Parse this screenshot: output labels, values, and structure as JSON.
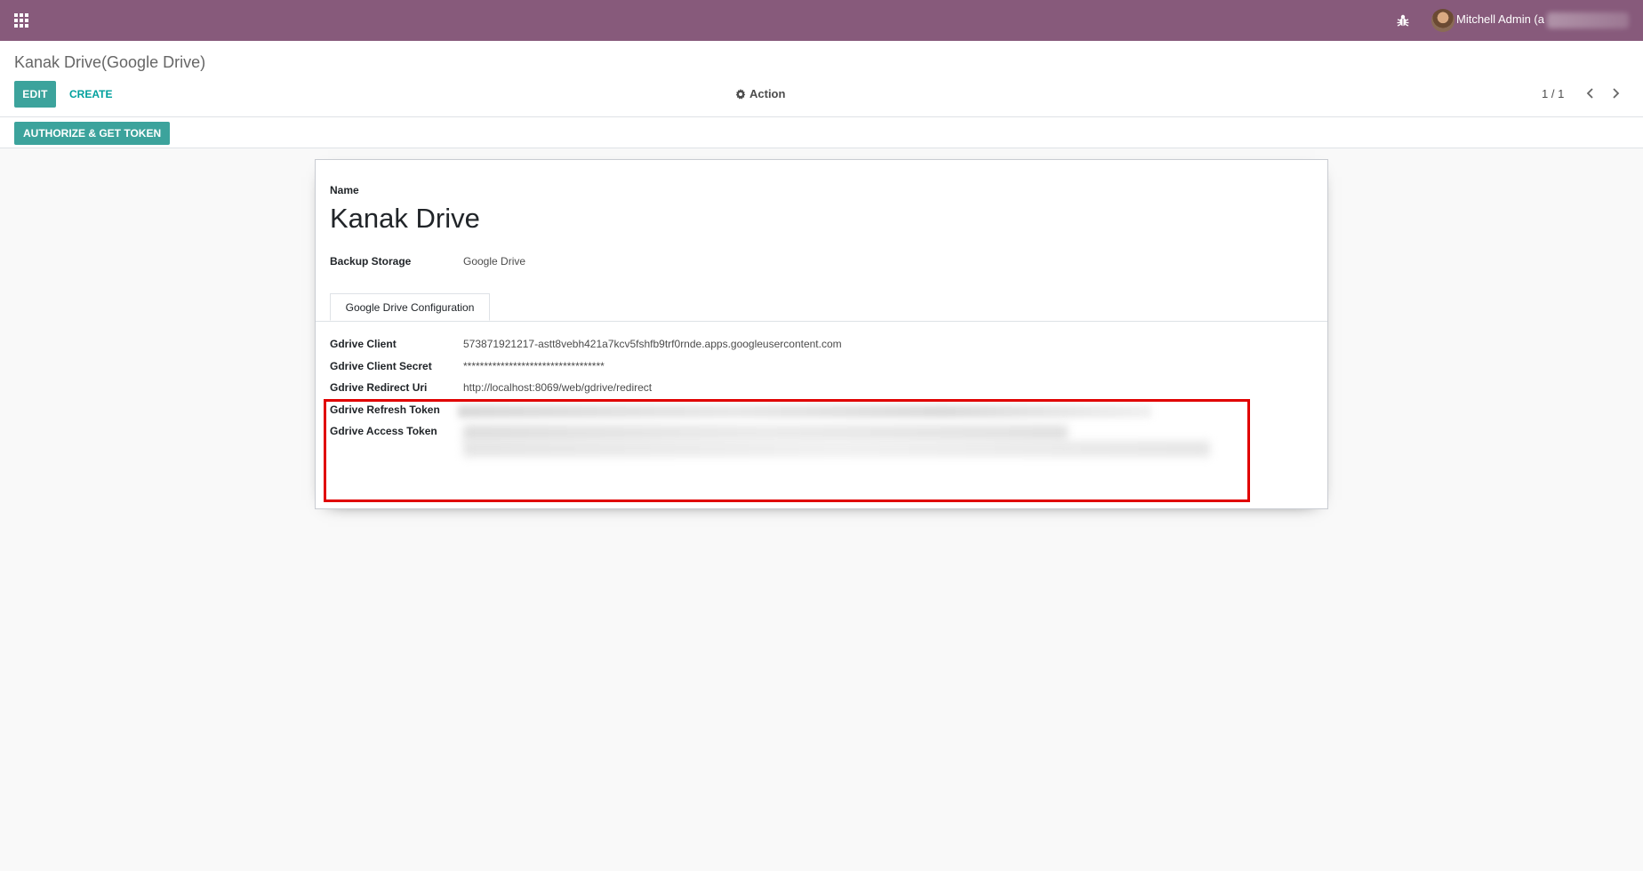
{
  "navbar": {
    "user_name": "Mitchell Admin (a"
  },
  "control_panel": {
    "breadcrumb": "Kanak Drive(Google Drive)",
    "edit_label": "EDIT",
    "create_label": "CREATE",
    "action_label": "Action",
    "pager_value": "1 / 1",
    "authorize_label": "AUTHORIZE & GET TOKEN"
  },
  "form": {
    "name_label": "Name",
    "name_value": "Kanak Drive",
    "backup_storage_label": "Backup Storage",
    "backup_storage_value": "Google Drive",
    "tab_label": "Google Drive Configuration",
    "fields": {
      "client_label": "Gdrive Client",
      "client_value": "573871921217-astt8vebh421a7kcv5fshfb9trf0rnde.apps.googleusercontent.com",
      "secret_label": "Gdrive Client Secret",
      "secret_value": "**********************************",
      "redirect_label": "Gdrive Redirect Uri",
      "redirect_value": "http://localhost:8069/web/gdrive/redirect",
      "refresh_label": "Gdrive Refresh Token",
      "access_label": "Gdrive Access Token"
    }
  },
  "colors": {
    "navbar": "#875a7b",
    "primary_button": "#3ca39c",
    "link": "#00a09d",
    "highlight": "#e00000"
  },
  "icons": [
    "apps-grid-icon",
    "bug-icon",
    "gear-icon",
    "chevron-left-icon",
    "chevron-right-icon"
  ]
}
